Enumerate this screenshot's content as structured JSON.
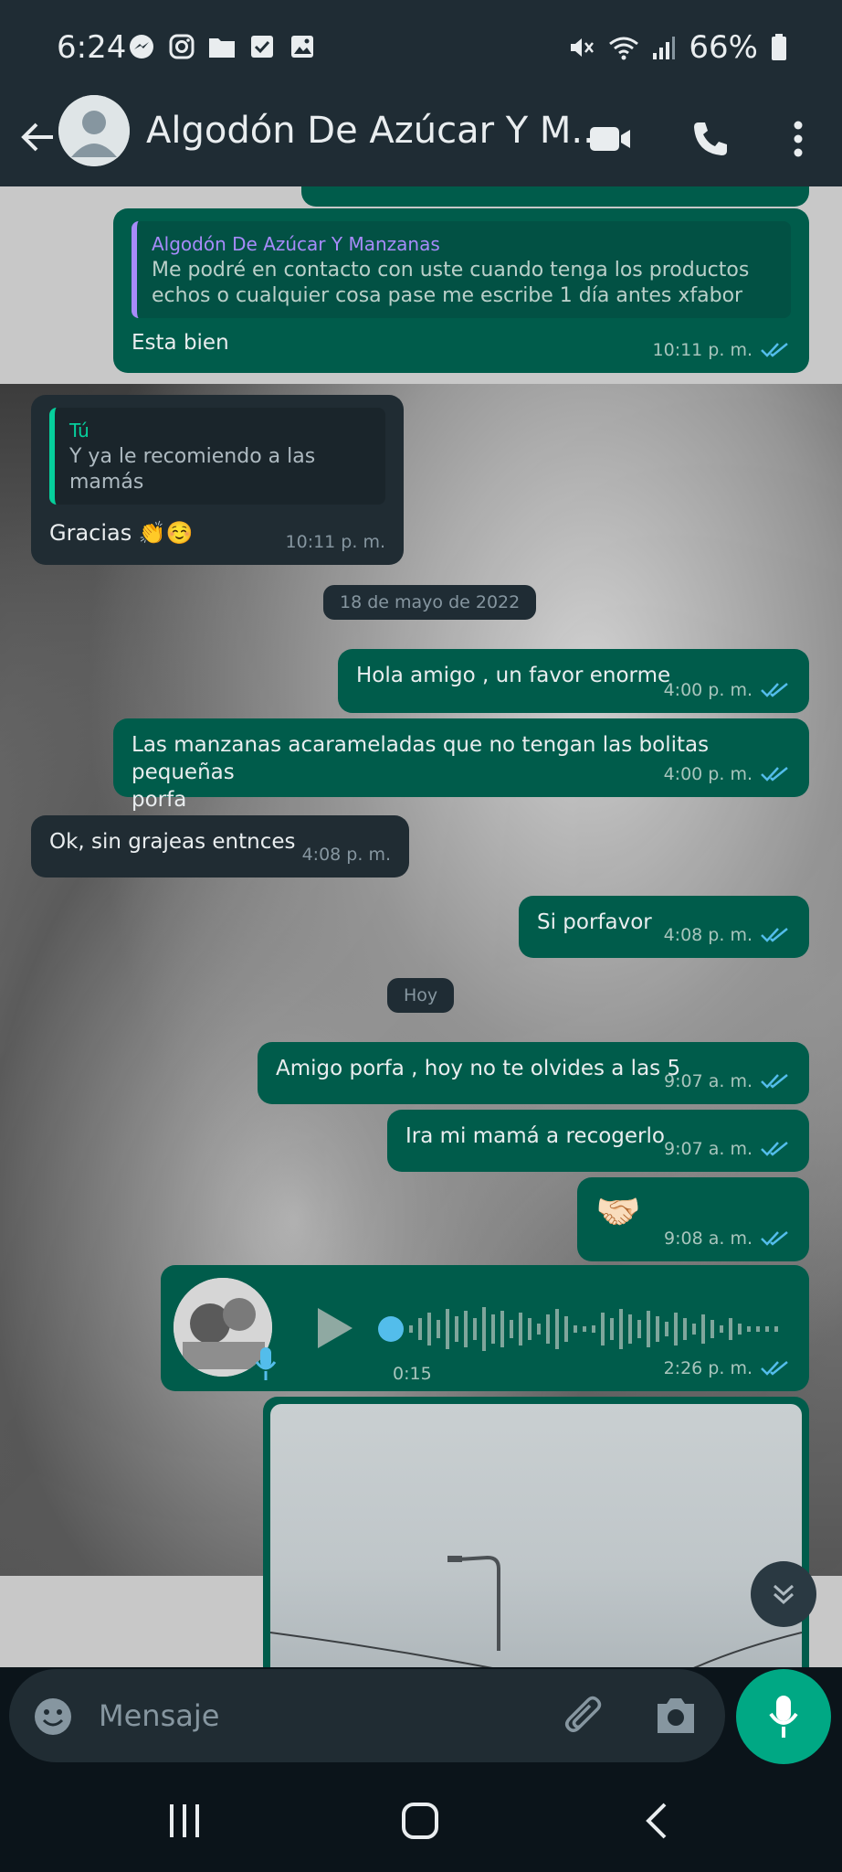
{
  "status": {
    "time": "6:24",
    "battery": "66%"
  },
  "header": {
    "contact_name": "Algodón De Azúcar Y M..."
  },
  "messages": {
    "m1": {
      "quote_name": "Algodón De Azúcar Y Manzanas",
      "quote_text_1": "Me podré en contacto con uste cuando tenga los productos",
      "quote_text_2": "echos o cualquier cosa pase me escribe 1 día antes xfabor",
      "text": "Esta bien",
      "time": "10:11 p. m."
    },
    "m2": {
      "quote_name": "Tú",
      "quote_text": "Y ya le recomiendo a las mamás",
      "text": "Gracias 👏☺️",
      "time": "10:11 p. m."
    },
    "date1": "18 de mayo de 2022",
    "m3": {
      "text": "Hola amigo , un favor enorme",
      "time": "4:00 p. m."
    },
    "m4": {
      "text_1": "Las manzanas acarameladas que no tengan las bolitas pequeñas",
      "text_2": "porfa",
      "time": "4:00 p. m."
    },
    "m5": {
      "text": "Ok, sin grajeas entnces",
      "time": "4:08 p. m."
    },
    "m6": {
      "text": "Si porfavor",
      "time": "4:08 p. m."
    },
    "date2": "Hoy",
    "m7": {
      "text": "Amigo porfa , hoy no te olvides a las 5",
      "time": "9:07 a. m."
    },
    "m8": {
      "text": "Ira mi mamá a recogerlo",
      "time": "9:07 a. m."
    },
    "m9": {
      "text": "🤝🏻",
      "time": "9:08 a. m."
    },
    "voice": {
      "duration": "0:15",
      "time": "2:26 p. m."
    }
  },
  "composer": {
    "placeholder": "Mensaje"
  },
  "colors": {
    "outgoing": "#005c4b",
    "incoming": "#202c33",
    "accent": "#00a884",
    "tick_read": "#53bdeb"
  }
}
